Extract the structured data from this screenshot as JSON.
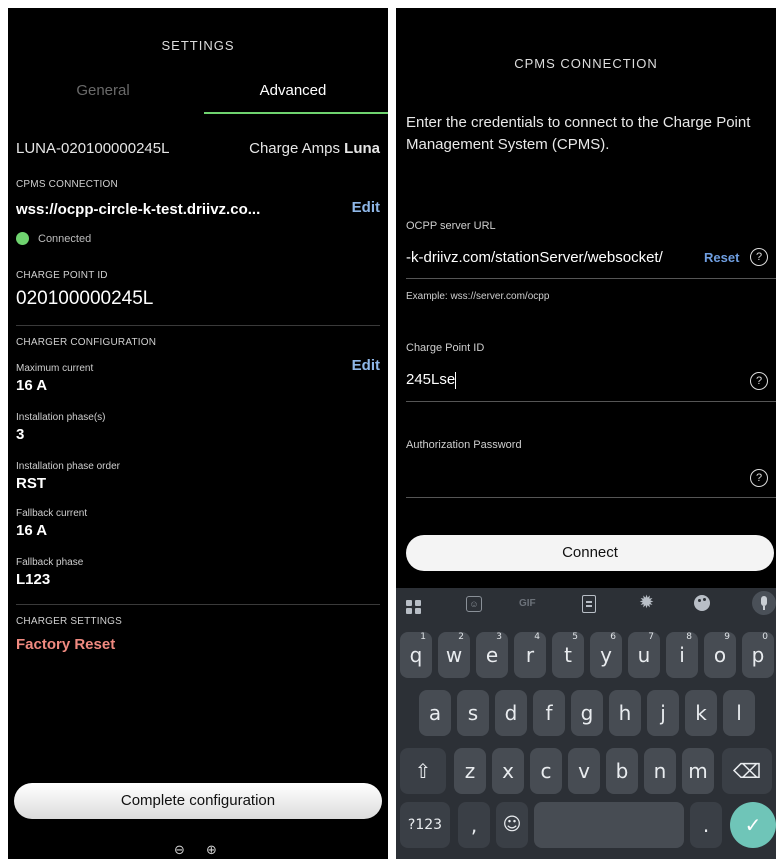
{
  "left": {
    "header_title": "SETTINGS",
    "tabs": [
      {
        "label": "General"
      },
      {
        "label": "Advanced"
      }
    ],
    "charger_id": "LUNA-020100000245L",
    "brand_prefix": "Charge Amps ",
    "brand_model": "Luna",
    "cpms": {
      "section_title": "CPMS CONNECTION",
      "url": "wss://ocpp-circle-k-test.driivz.co...",
      "edit_label": "Edit",
      "status": "Connected",
      "status_color": "#6fd36f"
    },
    "charge_point": {
      "label": "CHARGE POINT ID",
      "value": "020100000245L"
    },
    "config": {
      "section_title": "CHARGER CONFIGURATION",
      "edit_label": "Edit",
      "items": [
        {
          "label": "Maximum current",
          "value": "16 A"
        },
        {
          "label": "Installation phase(s)",
          "value": "3"
        },
        {
          "label": "Installation phase order",
          "value": "RST"
        },
        {
          "label": "Fallback current",
          "value": "16 A"
        },
        {
          "label": "Fallback phase",
          "value": "L123"
        }
      ]
    },
    "settings": {
      "section_title": "CHARGER SETTINGS",
      "factory_reset": "Factory Reset",
      "reset_color": "#f08a80"
    },
    "complete_button": "Complete configuration",
    "zoom_out_icon": "⊖",
    "zoom_in_icon": "⊕"
  },
  "right": {
    "header_title": "CPMS CONNECTION",
    "intro": "Enter the credentials to connect to the Charge Point Management System (CPMS).",
    "url_field": {
      "label": "OCPP server URL",
      "value": "-k-driivz.com/stationServer/websocket/",
      "reset": "Reset",
      "example": "Example: wss://server.com/ocpp"
    },
    "cp_field": {
      "label": "Charge Point ID",
      "value": "245Lse"
    },
    "pw_field": {
      "label": "Authorization Password",
      "value": ""
    },
    "connect_button": "Connect",
    "keyboard": {
      "toolbar": [
        "grid-icon",
        "sticker-icon",
        "gif-icon",
        "clipboard-icon",
        "gear-icon",
        "palette-icon",
        "mic-icon"
      ],
      "gif_label": "GIF",
      "row1": [
        [
          "q",
          "1"
        ],
        [
          "w",
          "2"
        ],
        [
          "e",
          "3"
        ],
        [
          "r",
          "4"
        ],
        [
          "t",
          "5"
        ],
        [
          "y",
          "6"
        ],
        [
          "u",
          "7"
        ],
        [
          "i",
          "8"
        ],
        [
          "o",
          "9"
        ],
        [
          "p",
          "0"
        ]
      ],
      "row2": [
        "a",
        "s",
        "d",
        "f",
        "g",
        "h",
        "j",
        "k",
        "l"
      ],
      "row3": [
        "z",
        "x",
        "c",
        "v",
        "b",
        "n",
        "m"
      ],
      "symbols_label": "?123",
      "comma_label": ",",
      "period_label": ".",
      "accent_color": "#6fc5b8"
    }
  }
}
